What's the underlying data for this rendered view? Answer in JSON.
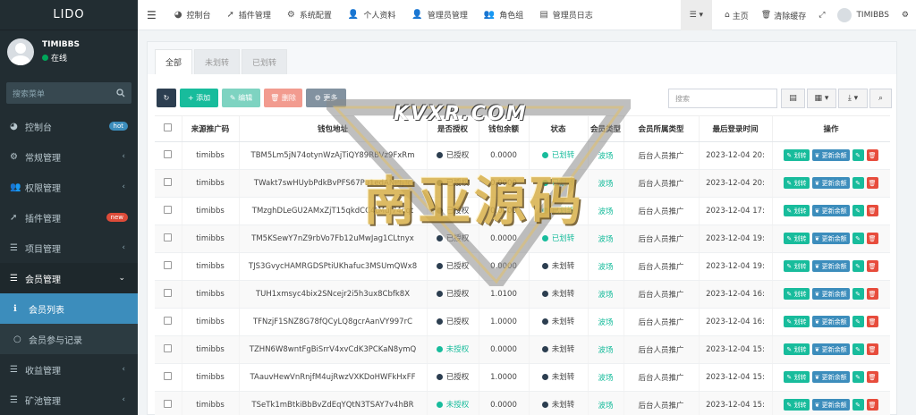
{
  "sidebar": {
    "logo": "LIDO",
    "user_name": "TIMIBBS",
    "user_status": "在线",
    "search_placeholder": "搜索菜单",
    "items": [
      {
        "label": "控制台",
        "icon": "dashboard-icon",
        "badge": "hot"
      },
      {
        "label": "常规管理",
        "icon": "cogs-icon"
      },
      {
        "label": "权限管理",
        "icon": "users-icon"
      },
      {
        "label": "插件管理",
        "icon": "rocket-icon",
        "badge": "new"
      },
      {
        "label": "项目管理",
        "icon": "list-icon"
      },
      {
        "label": "会员管理",
        "icon": "list-icon"
      },
      {
        "label": "会员列表",
        "icon": "info-icon"
      },
      {
        "label": "会员参与记录",
        "icon": "circle-icon"
      },
      {
        "label": "收益管理",
        "icon": "list-icon"
      },
      {
        "label": "矿池管理",
        "icon": "list-icon"
      }
    ]
  },
  "header": {
    "nav": [
      "控制台",
      "插件管理",
      "系统配置",
      "个人资料",
      "管理员管理",
      "角色组",
      "管理员日志"
    ],
    "right": {
      "home": "主页",
      "clear_cache": "清除缓存",
      "user": "TIMIBBS"
    }
  },
  "tabs": [
    "全部",
    "未划转",
    "已划转"
  ],
  "toolbar": {
    "add": "添加",
    "edit": "编辑",
    "delete": "删除",
    "more": "更多",
    "search_placeholder": "搜索"
  },
  "table": {
    "headers": [
      "来源推广码",
      "钱包地址",
      "是否授权",
      "钱包余额",
      "状态",
      "会员类型",
      "会员所属类型",
      "最后登录时间",
      "操作"
    ],
    "rows": [
      {
        "code": "timibbs",
        "addr": "TBM5Lm5jN74otynWzAjTiQY89RBVz9FxRm",
        "auth": "已授权",
        "auth_c": "navy",
        "bal": "0.0000",
        "status": "已划转",
        "status_c": "green",
        "type": "波场",
        "owner": "后台人员推广",
        "time": "2023-12-04 20:"
      },
      {
        "code": "timibbs",
        "addr": "TWakt7swHUybPdkBvPFS67Pu1edANPfjTc",
        "auth": "已授权",
        "auth_c": "navy",
        "bal": "0.0000",
        "status": "已划转",
        "status_c": "green",
        "type": "波场",
        "owner": "后台人员推广",
        "time": "2023-12-04 20:"
      },
      {
        "code": "timibbs",
        "addr": "TMzghDLeGU2AMxZjT15qkdCC4tMuJ74cqt",
        "auth": "已授权",
        "auth_c": "navy",
        "bal": "0.0000",
        "status": "已划转",
        "status_c": "green",
        "type": "波场",
        "owner": "后台人员推广",
        "time": "2023-12-04 17:"
      },
      {
        "code": "timibbs",
        "addr": "TM5KSewY7nZ9rbVo7Fb12uMwJag1CLtnyx",
        "auth": "已授权",
        "auth_c": "navy",
        "bal": "0.0000",
        "status": "已划转",
        "status_c": "green",
        "type": "波场",
        "owner": "后台人员推广",
        "time": "2023-12-04 19:"
      },
      {
        "code": "timibbs",
        "addr": "TJS3GvycHAMRGDSPtiUKhafuc3MSUmQWx8",
        "auth": "已授权",
        "auth_c": "navy",
        "bal": "0.0000",
        "status": "未划转",
        "status_c": "navy",
        "type": "波场",
        "owner": "后台人员推广",
        "time": "2023-12-04 19:"
      },
      {
        "code": "timibbs",
        "addr": "TUH1xmsyc4bix2SNcejr2i5h3ux8Cbfk8X",
        "auth": "已授权",
        "auth_c": "navy",
        "bal": "1.0100",
        "status": "未划转",
        "status_c": "navy",
        "type": "波场",
        "owner": "后台人员推广",
        "time": "2023-12-04 16:"
      },
      {
        "code": "timibbs",
        "addr": "TFNzjF1SNZ8G78fQCyLQ8gcrAanVY997rC",
        "auth": "已授权",
        "auth_c": "navy",
        "bal": "1.0000",
        "status": "未划转",
        "status_c": "navy",
        "type": "波场",
        "owner": "后台人员推广",
        "time": "2023-12-04 16:"
      },
      {
        "code": "timibbs",
        "addr": "TZHN6W8wntFgBiSrrV4xvCdK3PCKaN8ymQ",
        "auth": "未授权",
        "auth_c": "green",
        "bal": "0.0000",
        "status": "未划转",
        "status_c": "navy",
        "type": "波场",
        "owner": "后台人员推广",
        "time": "2023-12-04 15:"
      },
      {
        "code": "timibbs",
        "addr": "TAauvHewVnRnjfM4ujRwzVXKDoHWFkHxFF",
        "auth": "已授权",
        "auth_c": "navy",
        "bal": "1.0000",
        "status": "未划转",
        "status_c": "navy",
        "type": "波场",
        "owner": "后台人员推广",
        "time": "2023-12-04 15:"
      },
      {
        "code": "timibbs",
        "addr": "TSeTk1mBtkiBbBvZdEqYQtN3TSAY7v4hBR",
        "auth": "未授权",
        "auth_c": "green",
        "bal": "0.0000",
        "status": "未划转",
        "status_c": "navy",
        "type": "波场",
        "owner": "后台人员推广",
        "time": "2023-12-04 15:"
      }
    ],
    "ops": {
      "transfer": "划转",
      "update": "更新余额"
    }
  },
  "watermark": {
    "top": "KVXR.COM",
    "main": "南亚源码"
  },
  "colors": {
    "sidebar_bg": "#222d32",
    "primary": "#3c8dbc",
    "success": "#18bc9c",
    "danger": "#e74c3c",
    "navy": "#2c3e50"
  }
}
